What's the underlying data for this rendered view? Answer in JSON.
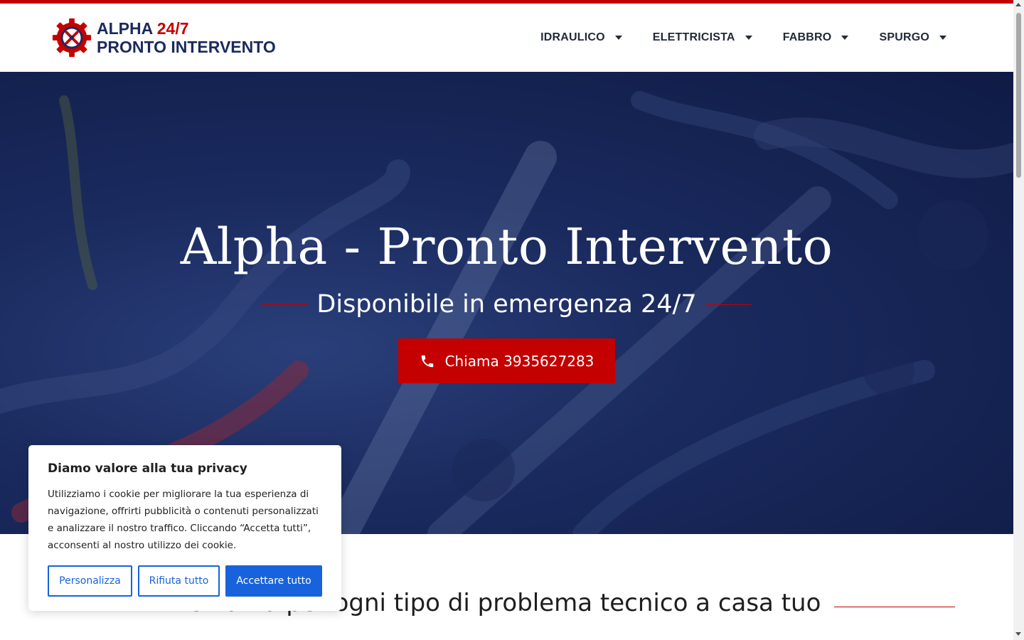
{
  "brand": {
    "line1_main": "ALPHA",
    "line1_accent": "24/7",
    "line2": "PRONTO INTERVENTO",
    "colors": {
      "red": "#c40000",
      "navy": "#1b2a5c"
    }
  },
  "nav": {
    "items": [
      {
        "label": "IDRAULICO"
      },
      {
        "label": "ELETTRICISTA"
      },
      {
        "label": "FABBRO"
      },
      {
        "label": "SPURGO"
      }
    ]
  },
  "hero": {
    "title": "Alpha - Pronto Intervento",
    "subtitle": "Disponibile in emergenza 24/7",
    "cta_label": "Chiama 3935627283",
    "cta_icon": "phone-icon"
  },
  "section": {
    "title": "Chiama per ogni tipo di problema tecnico a casa tuo"
  },
  "cookie": {
    "title": "Diamo valore alla tua privacy",
    "text": "Utilizziamo i cookie per migliorare la tua esperienza di navigazione, offrirti pubblicità o contenuti personalizzati e analizzare il nostro traffico. Cliccando “Accetta tutti”, acconsenti al nostro utilizzo dei cookie.",
    "btn_customize": "Personalizza",
    "btn_reject": "Rifiuta tutto",
    "btn_accept": "Accettare tutto",
    "accent": "#1863dc"
  }
}
